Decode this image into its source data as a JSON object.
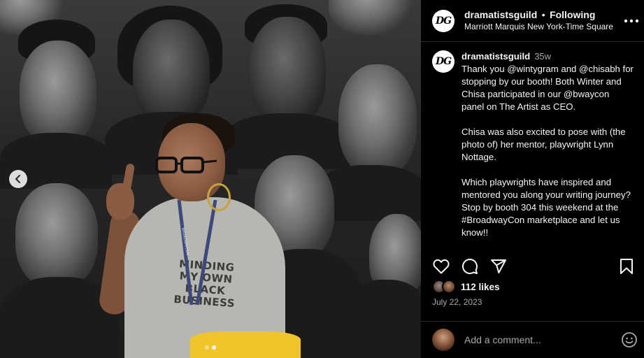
{
  "post": {
    "username": "dramatistsguild",
    "avatar_initials": "DG",
    "separator": "•",
    "follow_state": "Following",
    "location": "Marriott Marquis New York-Time Square"
  },
  "photo": {
    "shirt_text": "MINDING MY OWN BLACK BUSINESS",
    "lanyard_text": "BROADWAYCON"
  },
  "caption": {
    "username": "dramatistsguild",
    "time": "35w",
    "paragraphs": [
      "Thank you @wintygram and @chisabh for stopping by our booth! Both Winter and Chisa participated in our @bwaycon panel on The Artist as CEO.",
      "Chisa was also excited to pose with (the photo of) her mentor, playwright Lynn Nottage.",
      "Which playwrights have inspired and mentored you along your writing journey? Stop by booth 304 this weekend at the #BroadwayCon marketplace and let us know!!"
    ]
  },
  "engagement": {
    "likes": "112 likes",
    "date": "July 22, 2023"
  },
  "comment": {
    "placeholder": "Add a comment..."
  },
  "icons": {
    "like": "heart-icon",
    "comment": "comment-icon",
    "share": "paper-plane-icon",
    "save": "bookmark-icon",
    "more": "more-horizontal-icon",
    "emoji": "emoji-icon",
    "prev": "chevron-left-icon"
  }
}
